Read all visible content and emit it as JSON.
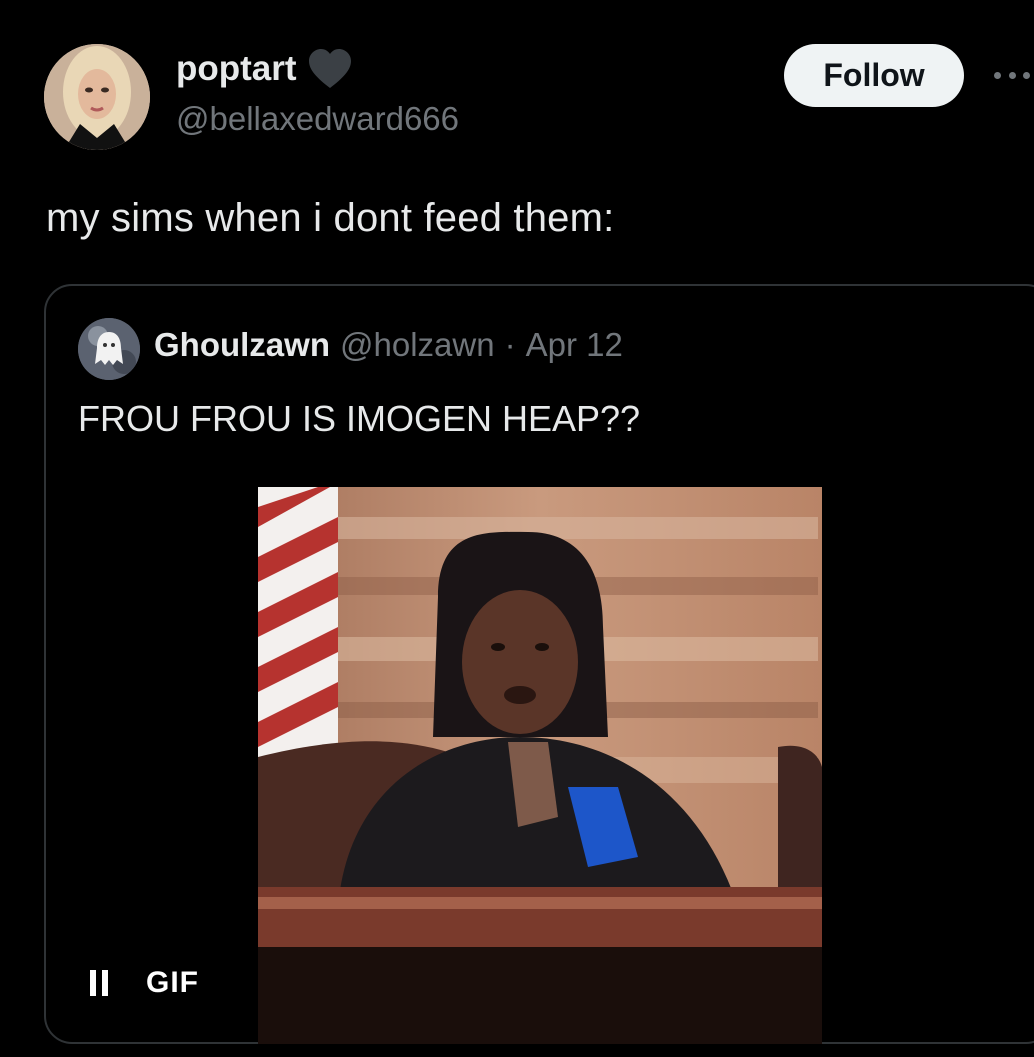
{
  "post": {
    "display_name": "poptart",
    "display_name_badge_icon": "black-heart-icon",
    "handle": "@bellaxedward666",
    "follow_label": "Follow",
    "more_icon": "more-horizontal-icon",
    "text": "my sims when i dont feed them:"
  },
  "quote": {
    "display_name": "Ghoulzawn",
    "handle": "@holzawn",
    "separator": "·",
    "date": "Apr 12",
    "text": "FROU FROU IS IMOGEN HEAP??",
    "media": {
      "type": "gif",
      "badge_label": "GIF",
      "control_icon": "pause-icon"
    }
  },
  "colors": {
    "background": "#000000",
    "primary_text": "#e7e9ea",
    "secondary_text": "#71767b",
    "border": "#2f3336",
    "follow_button_bg": "#eff3f4"
  }
}
